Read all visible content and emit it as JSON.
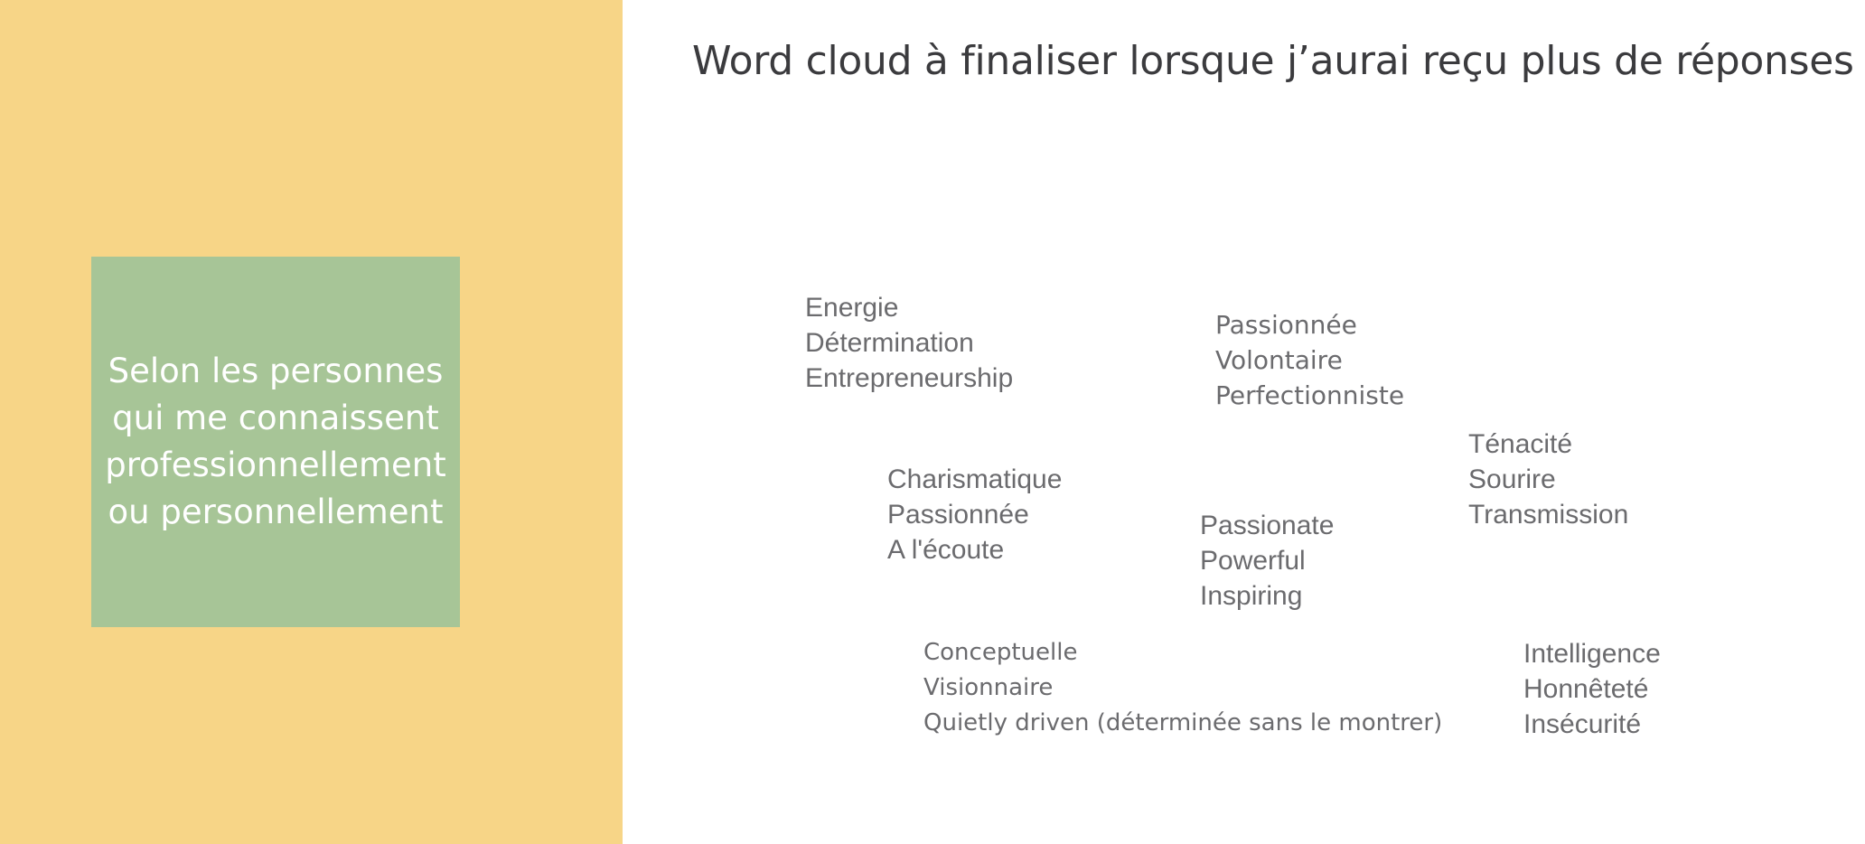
{
  "slide": {
    "title": "Word cloud à finaliser lorsque j’aurai reçu plus de réponses",
    "sidebar_text": "Selon les personnes\nqui me connaissent\nprofessionnellement\nou personnellement"
  },
  "colors": {
    "left_panel": "#f7d587",
    "green_box": "#a7c597",
    "title_text": "#3b3b3e",
    "word_text": "#6b6b6e"
  },
  "word_groups": [
    [
      "Energie",
      "Détermination",
      "Entrepreneurship"
    ],
    [
      "Passionnée",
      "Volontaire",
      "Perfectionniste"
    ],
    [
      "Charismatique",
      "Passionnée",
      "A l'écoute"
    ],
    [
      "Passionate",
      "Powerful",
      "Inspiring"
    ],
    [
      "Ténacité",
      "Sourire",
      "Transmission"
    ],
    [
      "Conceptuelle",
      "Visionnaire",
      "Quietly driven (déterminée sans le montrer)"
    ],
    [
      "Intelligence",
      "Honnêteté",
      "Insécurité"
    ]
  ]
}
